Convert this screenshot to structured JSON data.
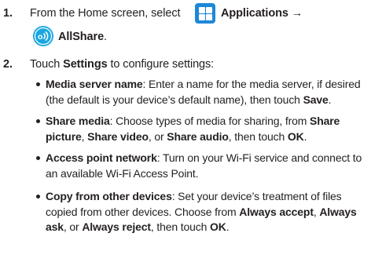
{
  "step1": {
    "number": "1.",
    "prefix": "From the Home screen, select",
    "applications_label": "Applications",
    "arrow": "→",
    "allshare_label": "AllShare",
    "period": ".",
    "icons": {
      "applications": "applications-grid-icon",
      "allshare": "allshare-icon"
    }
  },
  "step2": {
    "number": "2.",
    "prefix": "Touch",
    "settings_label": "Settings",
    "suffix": "to configure settings:"
  },
  "bullets": [
    {
      "term": "Media server name",
      "line1": ": Enter a name for the media server, if desired",
      "line2": "(the default is your device’s default name), then touch",
      "save": "Save",
      "end": "."
    },
    {
      "term": "Share media",
      "line1a": ": Choose types of media for sharing, from",
      "share_picture_a": "Share",
      "share_picture_b": "picture",
      "comma1": ",",
      "share_video": "Share video",
      "or": ", or",
      "share_audio": "Share audio",
      "then_touch": ", then touch",
      "ok": "OK",
      "end": "."
    },
    {
      "term": "Access point network",
      "line1": ": Turn on your Wi-Fi service and connect to",
      "line2": "an available Wi-Fi Access Point."
    },
    {
      "term": "Copy from other devices",
      "line1": ": Set your device’s treatment of files",
      "line2a": "copied from other devices. Choose from",
      "always_accept": "Always accept",
      "comma": ",",
      "always_a": "Always",
      "always_b": "ask",
      "or": ", or",
      "always_reject": "Always reject",
      "then_touch": ", then touch",
      "ok": "OK",
      "end": "."
    }
  ],
  "colors": {
    "text": "#231f20",
    "applications_icon": "#1e88d8",
    "allshare_icon": "#1aa7e0"
  }
}
